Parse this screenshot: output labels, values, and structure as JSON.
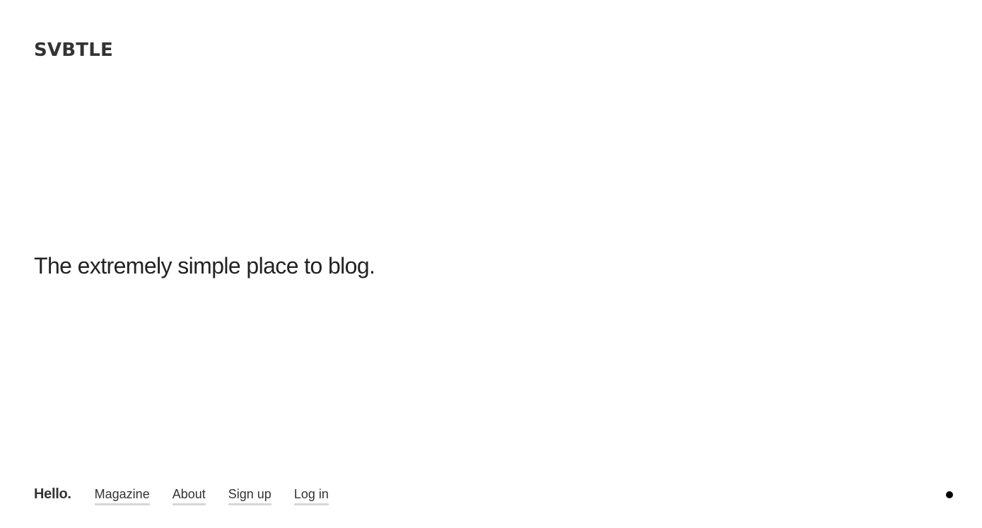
{
  "header": {
    "logo_text": "SVBTLE"
  },
  "main": {
    "tagline": "The extremely simple place to blog."
  },
  "footer": {
    "greeting": "Hello.",
    "nav": [
      {
        "label": "Magazine"
      },
      {
        "label": "About"
      },
      {
        "label": "Sign up"
      },
      {
        "label": "Log in"
      }
    ]
  },
  "colors": {
    "text": "#333333",
    "link_underline": "#d7d7d7",
    "dot": "#000000",
    "background": "#ffffff"
  },
  "icons": {
    "corner_dot": "dot-icon"
  }
}
